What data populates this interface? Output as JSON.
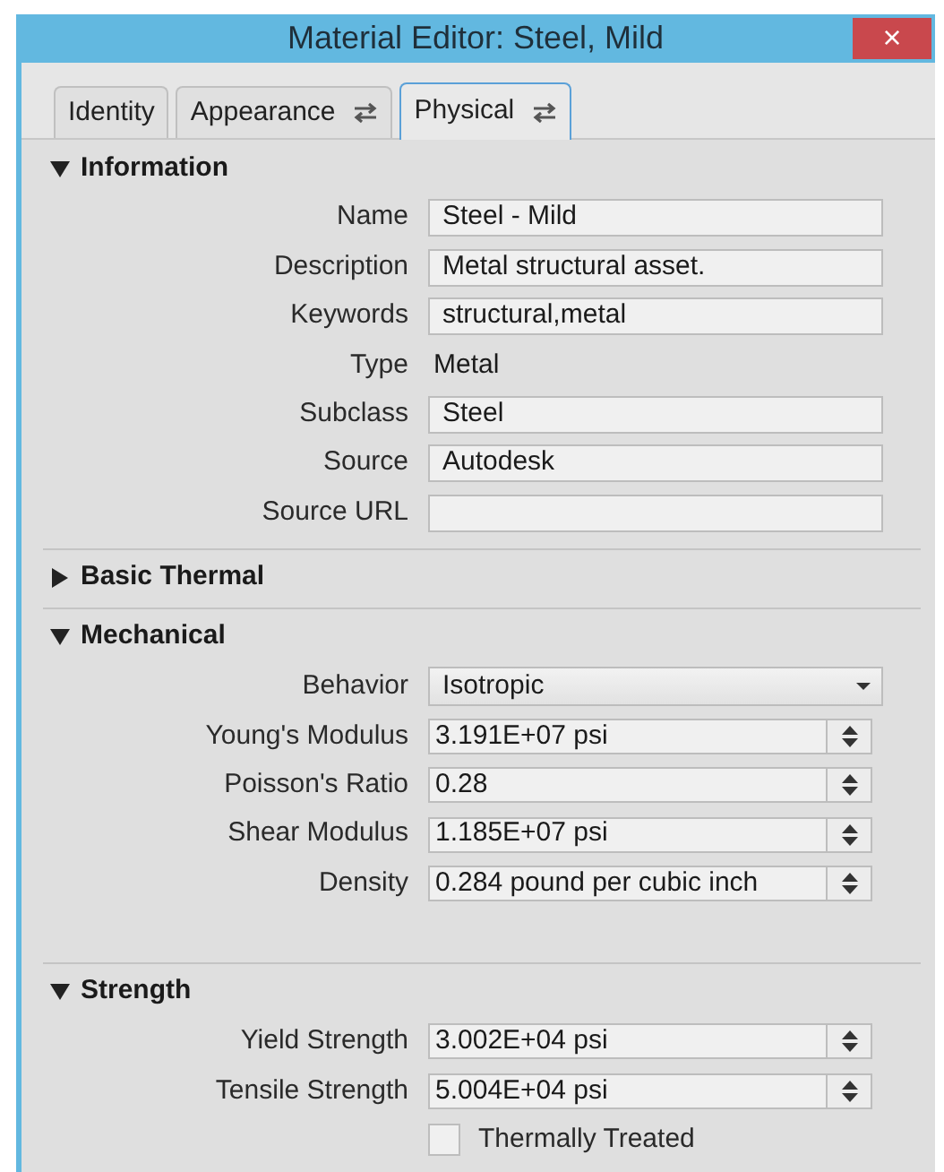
{
  "window": {
    "title": "Material Editor: Steel, Mild",
    "close": "×"
  },
  "tabs": [
    {
      "label": "Identity",
      "selected": false,
      "swap_icon": false
    },
    {
      "label": "Appearance",
      "selected": false,
      "swap_icon": true
    },
    {
      "label": "Physical",
      "selected": true,
      "swap_icon": true
    }
  ],
  "sections": [
    {
      "title": "Information",
      "expanded": true,
      "rows": [
        {
          "kind": "field",
          "label": "Name",
          "value": "Steel - Mild"
        },
        {
          "kind": "field",
          "label": "Description",
          "value": "Metal structural asset."
        },
        {
          "kind": "field",
          "label": "Keywords",
          "value": "structural,metal"
        },
        {
          "kind": "text",
          "label": "Type",
          "value": "Metal"
        },
        {
          "kind": "field",
          "label": "Subclass",
          "value": "Steel"
        },
        {
          "kind": "field",
          "label": "Source",
          "value": "Autodesk"
        },
        {
          "kind": "field",
          "label": "Source URL"
        }
      ]
    },
    {
      "title": "Basic Thermal",
      "expanded": false
    },
    {
      "title": "Mechanical",
      "expanded": true,
      "rows": [
        {
          "kind": "dropdown",
          "label": "Behavior",
          "value": "Isotropic"
        },
        {
          "kind": "spinner",
          "label": "Young's Modulus",
          "value": "3.191E+07 psi"
        },
        {
          "kind": "spinner",
          "label": "Poisson's Ratio",
          "value": "0.28"
        },
        {
          "kind": "spinner",
          "label": "Shear Modulus",
          "value": "1.185E+07 psi"
        },
        {
          "kind": "spinner",
          "label": "Density",
          "value": "0.284 pound per cubic inch"
        }
      ]
    },
    {
      "title": "Strength",
      "expanded": true,
      "rows": [
        {
          "kind": "spinner",
          "label": "Yield Strength",
          "value": "3.002E+04 psi"
        },
        {
          "kind": "spinner",
          "label": "Tensile Strength",
          "value": "5.004E+04 psi"
        },
        {
          "kind": "checkbox",
          "label": "Thermally Treated",
          "checked": false
        }
      ]
    }
  ]
}
